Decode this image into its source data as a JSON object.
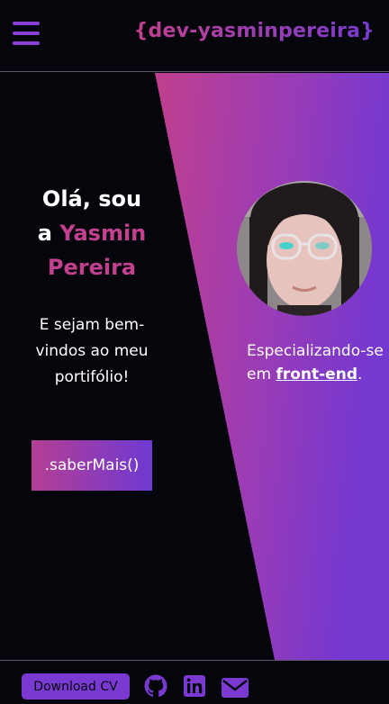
{
  "header": {
    "logo": "{dev-yasminpereira}",
    "menu_icon": "hamburger-menu-icon"
  },
  "hero": {
    "greeting_line1": "Olá, sou",
    "greeting_prefix": "a ",
    "name_part1": "Yasmin",
    "name_part2": "Pereira",
    "welcome_text": "E sejam bem-vindos ao meu portifólio!",
    "cta_label": ".saberMais()",
    "spec_prefix": "Especializando-se em ",
    "spec_highlight": "front-end",
    "spec_suffix": "."
  },
  "footer": {
    "cv_label": "Download CV",
    "icons": [
      "github-icon",
      "linkedin-icon",
      "email-icon"
    ]
  },
  "colors": {
    "background": "#05050c",
    "brand_pink": "#c2408f",
    "brand_purple": "#7a3ad2"
  }
}
